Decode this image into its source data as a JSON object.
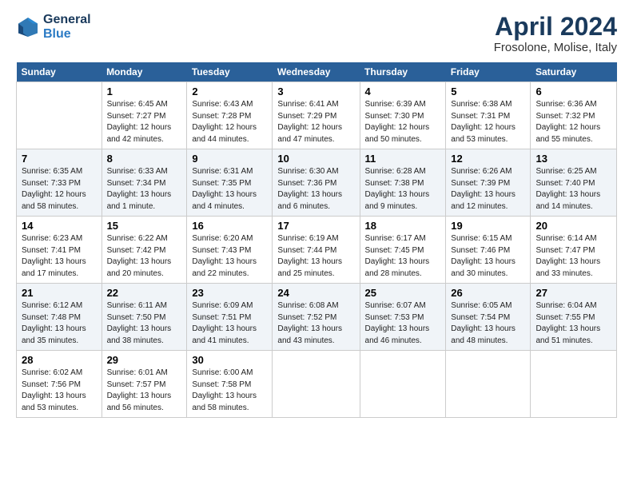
{
  "header": {
    "logo_line1": "General",
    "logo_line2": "Blue",
    "title": "April 2024",
    "subtitle": "Frosolone, Molise, Italy"
  },
  "columns": [
    "Sunday",
    "Monday",
    "Tuesday",
    "Wednesday",
    "Thursday",
    "Friday",
    "Saturday"
  ],
  "weeks": [
    [
      {
        "day": "",
        "info": ""
      },
      {
        "day": "1",
        "info": "Sunrise: 6:45 AM\nSunset: 7:27 PM\nDaylight: 12 hours\nand 42 minutes."
      },
      {
        "day": "2",
        "info": "Sunrise: 6:43 AM\nSunset: 7:28 PM\nDaylight: 12 hours\nand 44 minutes."
      },
      {
        "day": "3",
        "info": "Sunrise: 6:41 AM\nSunset: 7:29 PM\nDaylight: 12 hours\nand 47 minutes."
      },
      {
        "day": "4",
        "info": "Sunrise: 6:39 AM\nSunset: 7:30 PM\nDaylight: 12 hours\nand 50 minutes."
      },
      {
        "day": "5",
        "info": "Sunrise: 6:38 AM\nSunset: 7:31 PM\nDaylight: 12 hours\nand 53 minutes."
      },
      {
        "day": "6",
        "info": "Sunrise: 6:36 AM\nSunset: 7:32 PM\nDaylight: 12 hours\nand 55 minutes."
      }
    ],
    [
      {
        "day": "7",
        "info": "Sunrise: 6:35 AM\nSunset: 7:33 PM\nDaylight: 12 hours\nand 58 minutes."
      },
      {
        "day": "8",
        "info": "Sunrise: 6:33 AM\nSunset: 7:34 PM\nDaylight: 13 hours\nand 1 minute."
      },
      {
        "day": "9",
        "info": "Sunrise: 6:31 AM\nSunset: 7:35 PM\nDaylight: 13 hours\nand 4 minutes."
      },
      {
        "day": "10",
        "info": "Sunrise: 6:30 AM\nSunset: 7:36 PM\nDaylight: 13 hours\nand 6 minutes."
      },
      {
        "day": "11",
        "info": "Sunrise: 6:28 AM\nSunset: 7:38 PM\nDaylight: 13 hours\nand 9 minutes."
      },
      {
        "day": "12",
        "info": "Sunrise: 6:26 AM\nSunset: 7:39 PM\nDaylight: 13 hours\nand 12 minutes."
      },
      {
        "day": "13",
        "info": "Sunrise: 6:25 AM\nSunset: 7:40 PM\nDaylight: 13 hours\nand 14 minutes."
      }
    ],
    [
      {
        "day": "14",
        "info": "Sunrise: 6:23 AM\nSunset: 7:41 PM\nDaylight: 13 hours\nand 17 minutes."
      },
      {
        "day": "15",
        "info": "Sunrise: 6:22 AM\nSunset: 7:42 PM\nDaylight: 13 hours\nand 20 minutes."
      },
      {
        "day": "16",
        "info": "Sunrise: 6:20 AM\nSunset: 7:43 PM\nDaylight: 13 hours\nand 22 minutes."
      },
      {
        "day": "17",
        "info": "Sunrise: 6:19 AM\nSunset: 7:44 PM\nDaylight: 13 hours\nand 25 minutes."
      },
      {
        "day": "18",
        "info": "Sunrise: 6:17 AM\nSunset: 7:45 PM\nDaylight: 13 hours\nand 28 minutes."
      },
      {
        "day": "19",
        "info": "Sunrise: 6:15 AM\nSunset: 7:46 PM\nDaylight: 13 hours\nand 30 minutes."
      },
      {
        "day": "20",
        "info": "Sunrise: 6:14 AM\nSunset: 7:47 PM\nDaylight: 13 hours\nand 33 minutes."
      }
    ],
    [
      {
        "day": "21",
        "info": "Sunrise: 6:12 AM\nSunset: 7:48 PM\nDaylight: 13 hours\nand 35 minutes."
      },
      {
        "day": "22",
        "info": "Sunrise: 6:11 AM\nSunset: 7:50 PM\nDaylight: 13 hours\nand 38 minutes."
      },
      {
        "day": "23",
        "info": "Sunrise: 6:09 AM\nSunset: 7:51 PM\nDaylight: 13 hours\nand 41 minutes."
      },
      {
        "day": "24",
        "info": "Sunrise: 6:08 AM\nSunset: 7:52 PM\nDaylight: 13 hours\nand 43 minutes."
      },
      {
        "day": "25",
        "info": "Sunrise: 6:07 AM\nSunset: 7:53 PM\nDaylight: 13 hours\nand 46 minutes."
      },
      {
        "day": "26",
        "info": "Sunrise: 6:05 AM\nSunset: 7:54 PM\nDaylight: 13 hours\nand 48 minutes."
      },
      {
        "day": "27",
        "info": "Sunrise: 6:04 AM\nSunset: 7:55 PM\nDaylight: 13 hours\nand 51 minutes."
      }
    ],
    [
      {
        "day": "28",
        "info": "Sunrise: 6:02 AM\nSunset: 7:56 PM\nDaylight: 13 hours\nand 53 minutes."
      },
      {
        "day": "29",
        "info": "Sunrise: 6:01 AM\nSunset: 7:57 PM\nDaylight: 13 hours\nand 56 minutes."
      },
      {
        "day": "30",
        "info": "Sunrise: 6:00 AM\nSunset: 7:58 PM\nDaylight: 13 hours\nand 58 minutes."
      },
      {
        "day": "",
        "info": ""
      },
      {
        "day": "",
        "info": ""
      },
      {
        "day": "",
        "info": ""
      },
      {
        "day": "",
        "info": ""
      }
    ]
  ]
}
